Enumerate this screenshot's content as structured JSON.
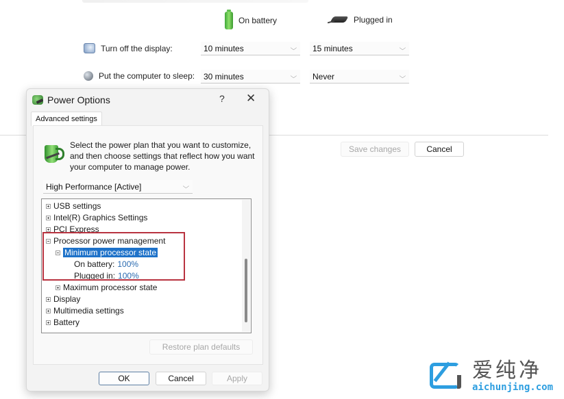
{
  "background_panel": {
    "columns": {
      "on_battery": "On battery",
      "plugged_in": "Plugged in"
    },
    "rows": [
      {
        "label": "Turn off the display:",
        "icon": "monitor-icon",
        "on_battery": "10 minutes",
        "plugged_in": "15 minutes"
      },
      {
        "label": "Put the computer to sleep:",
        "icon": "moon-icon",
        "on_battery": "30 minutes",
        "plugged_in": "Never"
      }
    ],
    "buttons": {
      "save": "Save changes",
      "cancel": "Cancel"
    }
  },
  "dialog": {
    "title": "Power Options",
    "help": "?",
    "close": "✕",
    "tab": "Advanced settings",
    "intro": "Select the power plan that you want to customize, and then choose settings that reflect how you want your computer to manage power.",
    "plan": "High Performance [Active]",
    "tree": {
      "usb": "USB settings",
      "intel": "Intel(R) Graphics Settings",
      "pci": "PCI Express",
      "ppm": "Processor power management",
      "min_state": "Minimum processor state",
      "on_battery_label": "On battery:",
      "on_battery_value": "100%",
      "plugged_label": "Plugged in:",
      "plugged_value": "100%",
      "max_state": "Maximum processor state",
      "display": "Display",
      "multimedia": "Multimedia settings",
      "battery": "Battery"
    },
    "restore": "Restore plan defaults",
    "ok": "OK",
    "cancel": "Cancel",
    "apply": "Apply"
  },
  "watermark": {
    "cn": "爱纯净",
    "en": "aichunjing.com"
  }
}
